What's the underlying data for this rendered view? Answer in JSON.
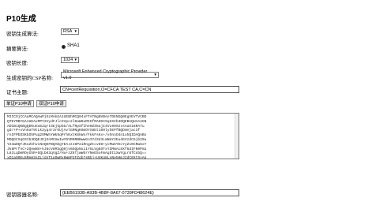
{
  "page": {
    "title": "P10生成"
  },
  "form": {
    "algo_label": "密钥生成算法:",
    "algo_value": "RSA",
    "digest_label": "摘要算法:",
    "digest_value": "SHA1",
    "keylen_label": "密钥长度:",
    "keylen_value": "1024",
    "csp_label": "生成密钥的CSP名称:",
    "csp_value": "Microsoft Enhanced Cryptographic Provider v1.0",
    "subject_label": "证书主题:",
    "subject_value": "CN=certRequisition,O=CFCA TEST CA,C=CN",
    "btn_p10": "单证P10申请",
    "btn_dual_p10": "双证P10申请",
    "container_label": "密钥容器名称:",
    "container_value": "{EEB6193B-A93B-4B8F-8A67-0739FD48624E}"
  },
  "output": {
    "text": "MIICOjCCAaMCAQAwPjELMAkGA1UEBhMCQ04xFTATBgNVBAoTDENGQ0EgVEVTVCBD\nQTEYMBYGA1UEAxMPY2VydFJlcXVpc2l0aW9uMIGfMA0GCSqGSIb3DQEBAQUAA4GN\nADCBiQKBgQDKuGvm2qrtSEjkpbG/ALfRpSfIhe9ZS5ajI4VL09SIssAaX18RA7u\ngd/+P+xVn9aT9tLk2yq4r3rOUjAvlGRNgK9mOYX8Et109lyhEPfBQDmVjac3f\nrnIFPEOSKbOhPuq2OMWnYWk9qPrhKxtK6kWs/FkkFsKx+/vOnnO4n1uhQIDAQABo\nMDQGCSqGSIb3DQEJDjEnMCUwIwYDVR0RBBwwGoIYd3d3LmNmY2EudGVzdC5jb20u\nY24wDQYJKoZIhvcNAQEFBQADgYEAJzJ8P2iRngZtcvD8+ycMw5YEcYyZx0CRw5xY\nJk8PrfnC+2QewNX+kJ6cV8M3gQ9jv6bQpNxi1Y5LVg8OTxYZMmAc8Xf6dIFN0Pm1\nL8zLqDmROyGhR+GQLbK3qVgZ/Hu+zZ6TjwW5rYNeE5oFmAqDt1XwYgLr8fCnbQ==\nxD1aQ0EuSRmH3sZLjdnT1pQwRx6WmP2FZqb7sBbj+U4Kq8LvNe5HmJ2dC0XtSyAq\nu9Mhf1Lr7cT3wYqK5gBdE2VoRz8aN4pQxJ6tH0sUcLmFyWb1eGk3iZ9PvX7DaR5n\nkzdTaF4eMqo2Rj8XyCwZsBnvL7hGp0A3tEqUrN9IY6sOkVbPxW1mJcDiF5gT3uQe\n=="
  }
}
